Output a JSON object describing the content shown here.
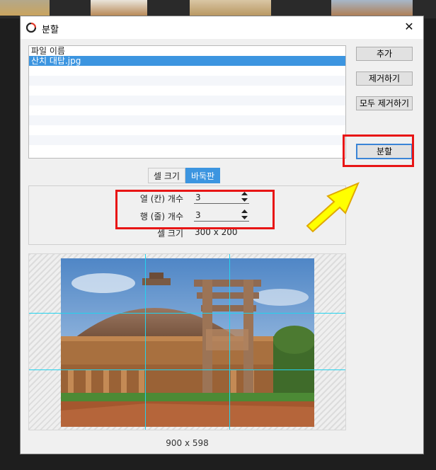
{
  "window": {
    "title": "분할",
    "close_label": "✕"
  },
  "file_list": {
    "header": "파일 이름",
    "items": [
      "산치 대탑.jpg"
    ],
    "selected_index": 0
  },
  "buttons": {
    "add": "추가",
    "remove": "제거하기",
    "remove_all": "모두 제거하기",
    "split": "분할"
  },
  "tabs": [
    {
      "label": "셀 크기",
      "active": false
    },
    {
      "label": "바둑판",
      "active": true
    }
  ],
  "grid_settings": {
    "columns_label": "열 (칸) 개수",
    "columns_value": "3",
    "rows_label": "행 (줄) 개수",
    "rows_value": "3",
    "cell_size_label": "셀 크기",
    "cell_size_value": "300 x 200"
  },
  "preview": {
    "image_size": "900 x 598"
  },
  "colors": {
    "accent": "#3c95e0",
    "highlight": "#e81515",
    "arrow_fill": "#ffff00",
    "grid_line": "#22d3ee"
  }
}
